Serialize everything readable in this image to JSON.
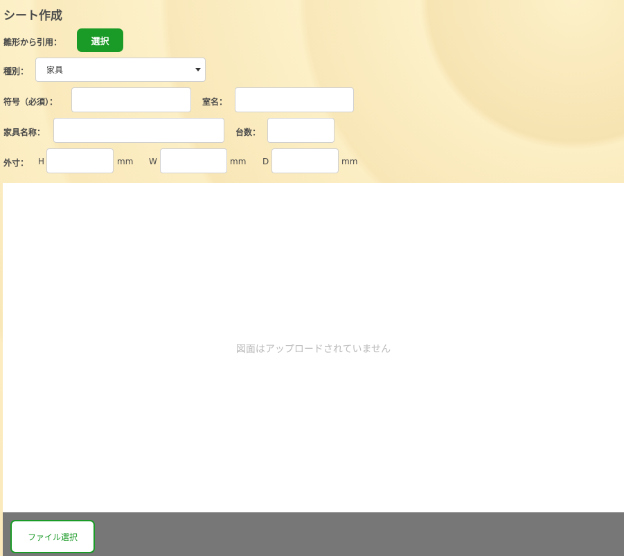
{
  "header": {
    "title": "シート作成"
  },
  "template": {
    "label": "雛形から引用：",
    "button_label": "選択"
  },
  "category": {
    "label": "種別：",
    "selected": "家具"
  },
  "code": {
    "label": "符号（必須）：",
    "value": ""
  },
  "room": {
    "label": "室名：",
    "value": ""
  },
  "furniture_name": {
    "label": "家具名称：",
    "value": ""
  },
  "count": {
    "label": "台数：",
    "value": ""
  },
  "dimensions": {
    "label": "外寸：",
    "h_label": "H",
    "w_label": "W",
    "d_label": "D",
    "unit": "mm",
    "h_value": "",
    "w_value": "",
    "d_value": ""
  },
  "preview": {
    "empty_message": "図面はアップロードされていません"
  },
  "footer": {
    "file_button_label": "ファイル選択"
  }
}
